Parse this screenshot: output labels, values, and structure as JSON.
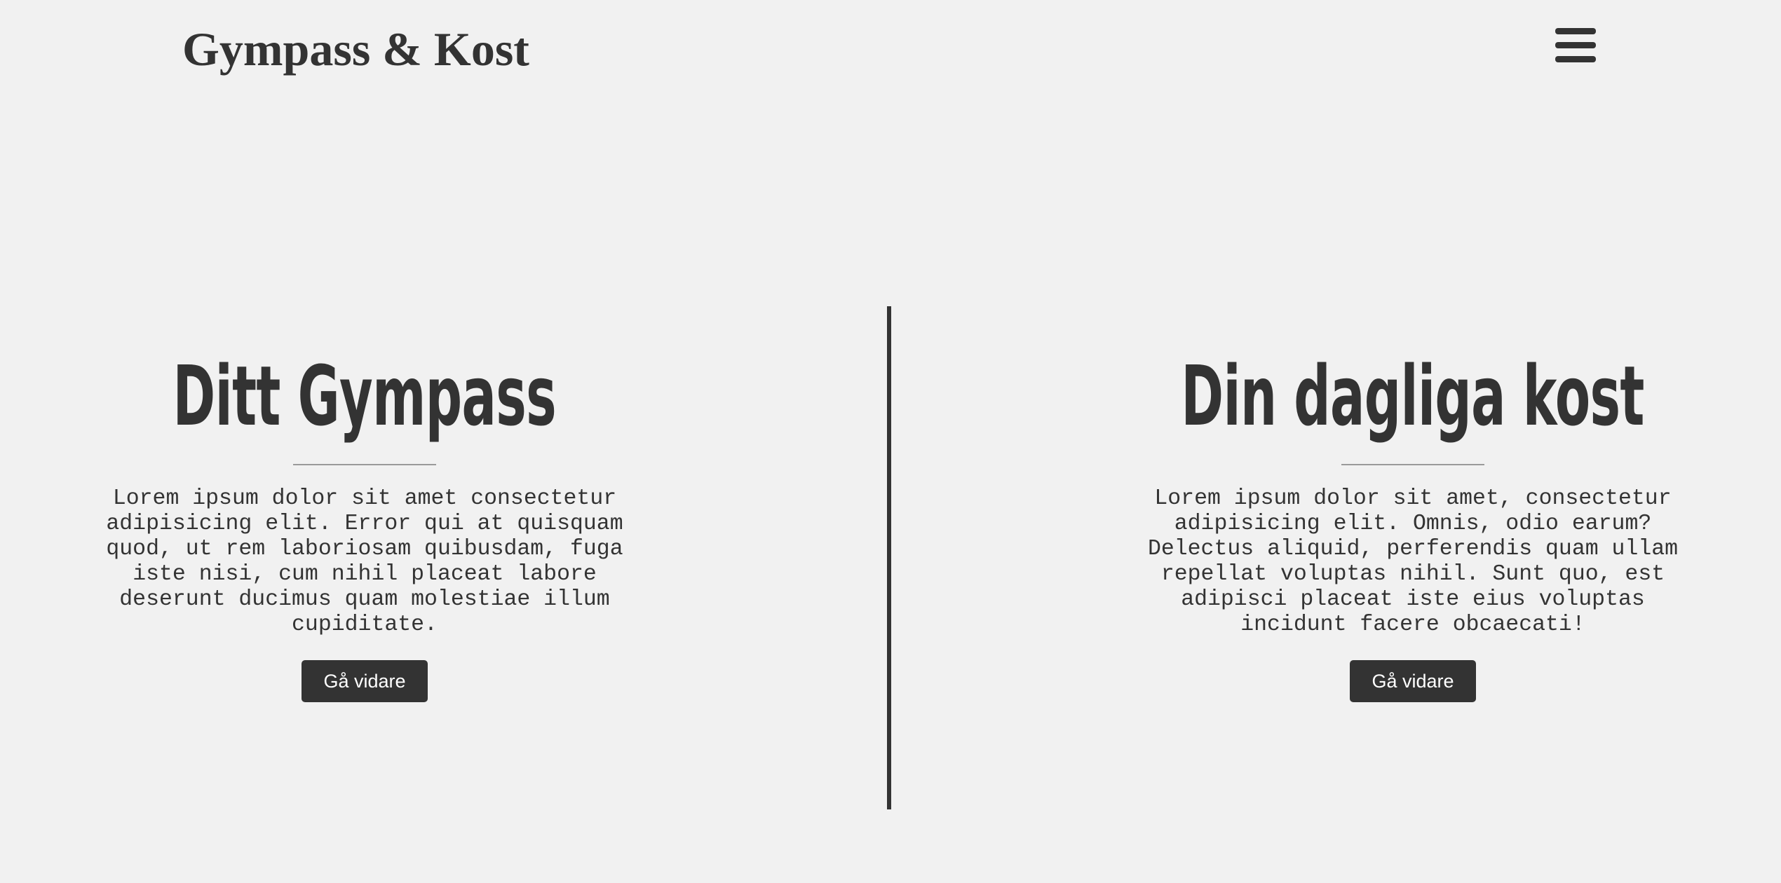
{
  "header": {
    "title": "Gympass & Kost",
    "menu_icon": "hamburger-menu-icon"
  },
  "panels": [
    {
      "heading": "Ditt Gympass",
      "text": "Lorem ipsum dolor sit amet consectetur adipisicing elit. Error qui at quisquam quod, ut rem laboriosam quibusdam, fuga iste nisi, cum nihil placeat labore deserunt ducimus quam molestiae illum cupiditate.",
      "button_label": "Gå vidare"
    },
    {
      "heading": "Din dagliga kost",
      "text": "Lorem ipsum dolor sit amet, consectetur adipisicing elit. Omnis, odio earum? Delectus aliquid, perferendis quam ullam repellat voluptas nihil. Sunt quo, est adipisci placeat iste eius voluptas incidunt facere obcaecati!",
      "button_label": "Gå vidare"
    }
  ],
  "colors": {
    "background": "#f1f1f1",
    "primary": "#333333",
    "button_text": "#ffffff",
    "rule": "#9a9a9a"
  }
}
